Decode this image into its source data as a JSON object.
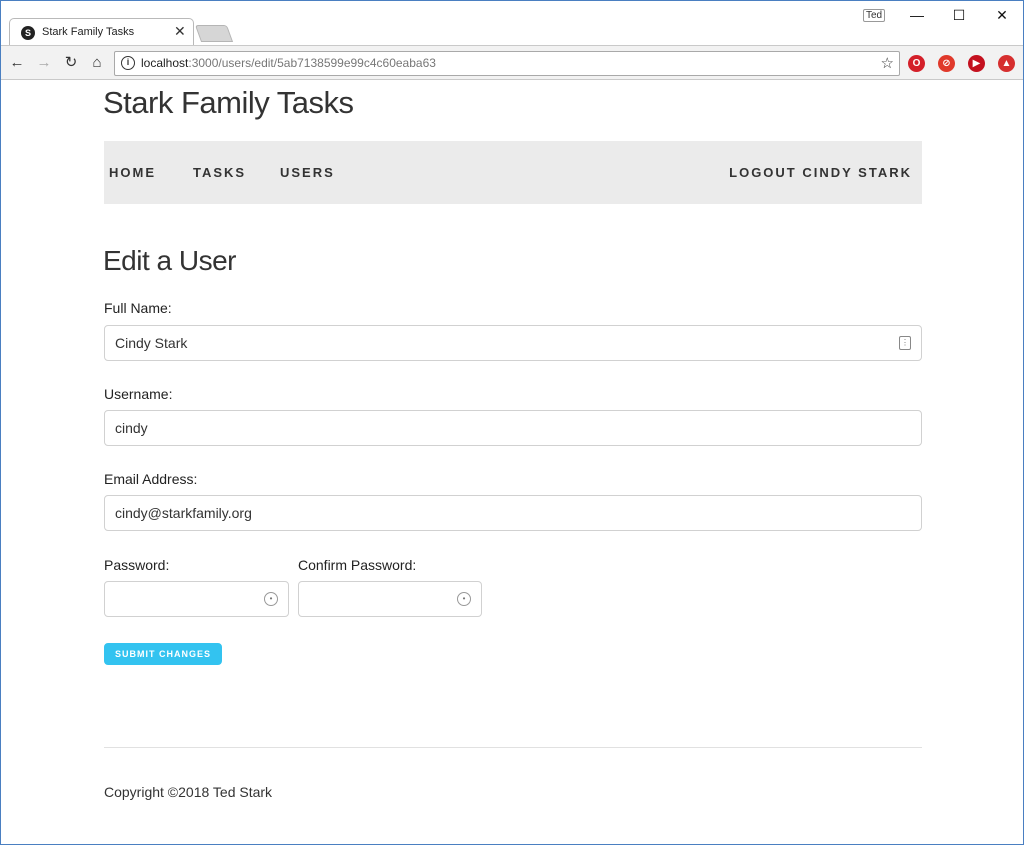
{
  "browser": {
    "tab_title": "Stark Family Tasks",
    "tab_favicon": "S",
    "tab_close": "✕",
    "profile_name": "Ted",
    "window_minimize": "—",
    "window_maximize": "☐",
    "window_close": "✕",
    "url_host": "localhost",
    "url_path": ":3000/users/edit/5ab7138599e99c4c60eaba63",
    "back": "←",
    "forward": "→",
    "reload": "↻",
    "home": "⌂",
    "bookmark": "☆",
    "info": "i",
    "extensions": [
      {
        "name": "opera-extension-icon",
        "glyph": "O",
        "color": "#d4202a"
      },
      {
        "name": "stop-extension-icon",
        "glyph": "⊘",
        "color": "#e0392b"
      },
      {
        "name": "play-extension-icon",
        "glyph": "▶",
        "color": "#c4111f"
      },
      {
        "name": "upload-extension-icon",
        "glyph": "▲",
        "color": "#d62f2f"
      }
    ]
  },
  "site": {
    "title": "Stark Family Tasks"
  },
  "nav": {
    "home": "HOME",
    "tasks": "TASKS",
    "users": "USERS",
    "logout": "LOGOUT CINDY STARK"
  },
  "form": {
    "heading": "Edit a User",
    "full_name_label": "Full Name:",
    "full_name_value": "Cindy Stark",
    "username_label": "Username:",
    "username_value": "cindy",
    "email_label": "Email Address:",
    "email_value": "cindy@starkfamily.org",
    "password_label": "Password:",
    "password_value": "",
    "confirm_label": "Confirm Password:",
    "confirm_value": "",
    "submit_label": "SUBMIT CHANGES"
  },
  "footer": {
    "copyright": "Copyright ©2018 Ted Stark"
  },
  "colors": {
    "accent": "#33c3f0",
    "navbar_bg": "#ebebeb"
  }
}
